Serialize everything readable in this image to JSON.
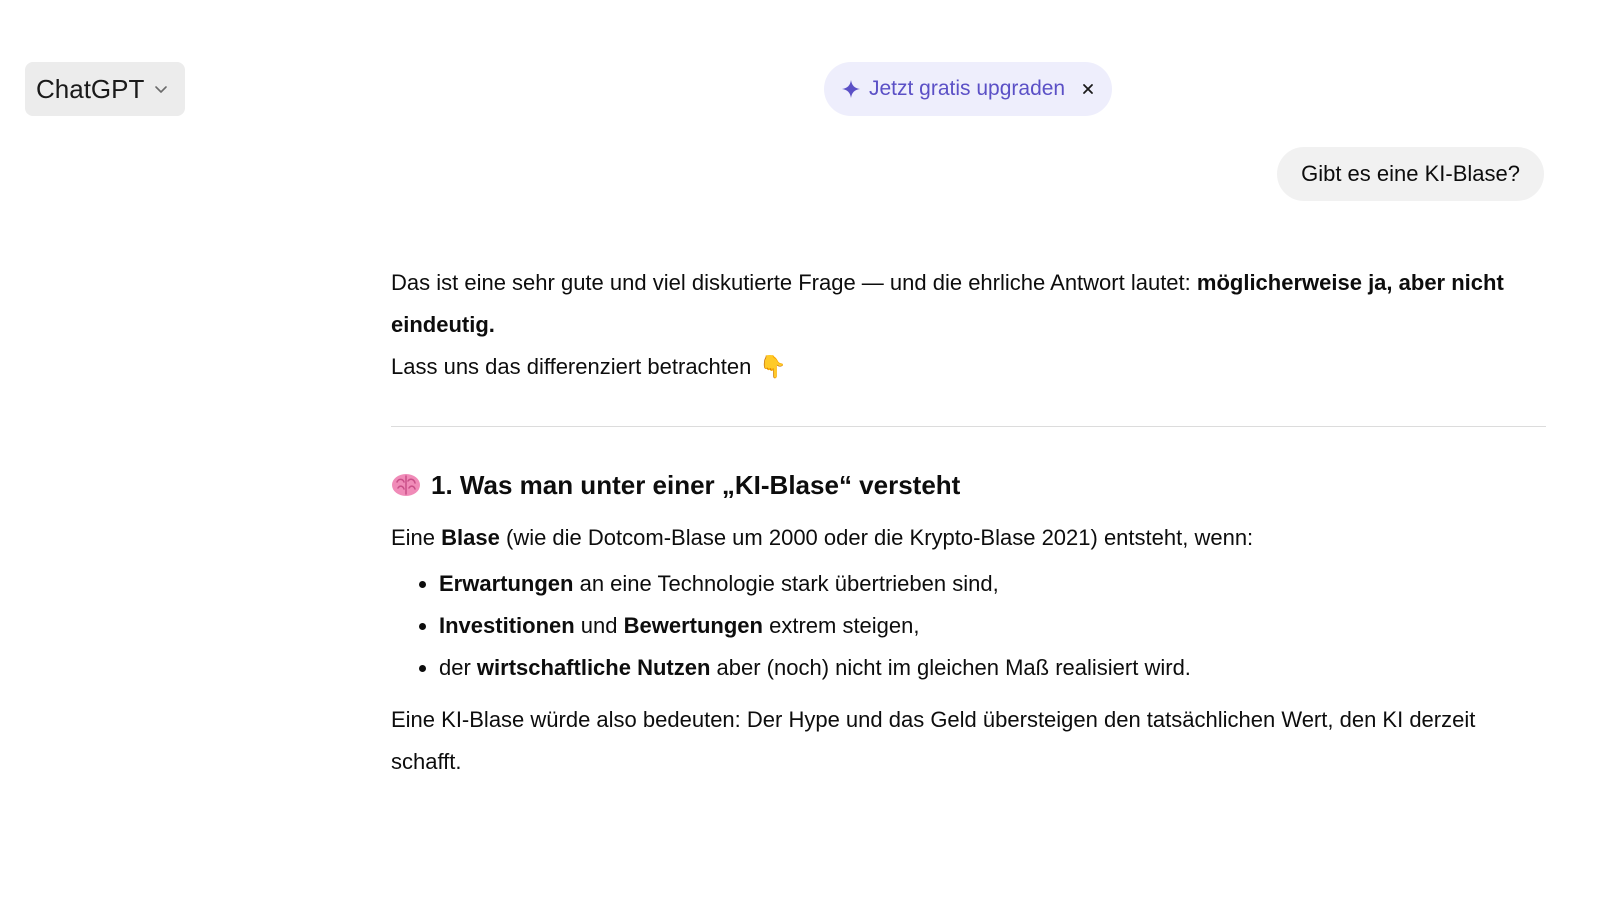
{
  "header": {
    "model_label": "ChatGPT",
    "model_chevron_icon": "chevron-down-icon",
    "upgrade_label": "Jetzt gratis upgraden",
    "upgrade_icon": "sparkle-icon",
    "upgrade_close": "×",
    "accent_color": "#5b50c6"
  },
  "conversation": {
    "user_message": "Gibt es eine KI-Blase?",
    "answer": {
      "intro_text": "Das ist eine sehr gute und viel diskutierte Frage — und die ehrliche Antwort lautet: ",
      "intro_bold": "möglicherweise ja, aber nicht eindeutig.",
      "intro_line2": "Lass uns das differenziert betrachten",
      "intro_line2_emoji": "👇",
      "section1": {
        "emoji": "🧠",
        "title": "1. Was man unter einer „KI-Blase“ versteht",
        "def_pre": "Eine ",
        "def_bold": "Blase",
        "def_post": " (wie die Dotcom-Blase um 2000 oder die Krypto-Blase 2021) entsteht, wenn:",
        "bullets": [
          {
            "b1": "Erwartungen",
            "t1": " an eine Technologie stark übertrieben sind,"
          },
          {
            "b1": "Investitionen",
            "t1": " und ",
            "b2": "Bewertungen",
            "t2": " extrem steigen,"
          },
          {
            "t0": "der ",
            "b1": "wirtschaftliche Nutzen",
            "t1": " aber (noch) nicht im gleichen Maß realisiert wird."
          }
        ],
        "closing": "Eine KI-Blase würde also bedeuten: Der Hype und das Geld übersteigen den tatsächlichen Wert, den KI derzeit schafft."
      }
    }
  }
}
